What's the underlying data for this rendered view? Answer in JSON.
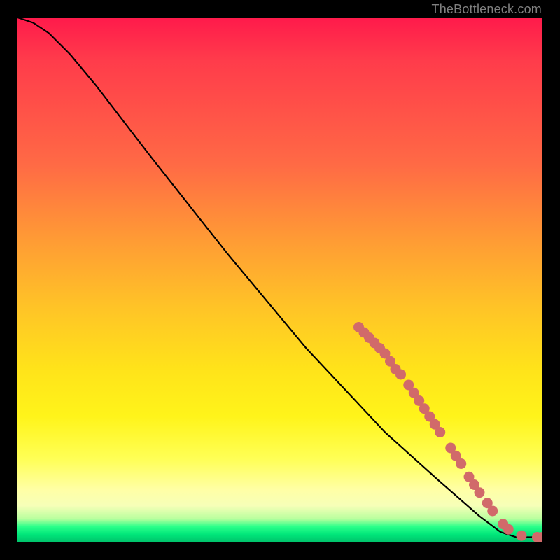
{
  "watermark": "TheBottleneck.com",
  "colors": {
    "marker": "#d16a6a",
    "curve": "#000000",
    "gradient_top": "#ff1a4b",
    "gradient_bottom": "#00c06a"
  },
  "chart_data": {
    "type": "line",
    "title": "",
    "xlabel": "",
    "ylabel": "",
    "xlim": [
      0,
      100
    ],
    "ylim": [
      0,
      100
    ],
    "grid": false,
    "legend": false,
    "curve_points": [
      {
        "x": 0,
        "y": 100
      },
      {
        "x": 3,
        "y": 99
      },
      {
        "x": 6,
        "y": 97
      },
      {
        "x": 10,
        "y": 93
      },
      {
        "x": 15,
        "y": 87
      },
      {
        "x": 25,
        "y": 74
      },
      {
        "x": 40,
        "y": 55
      },
      {
        "x": 55,
        "y": 37
      },
      {
        "x": 70,
        "y": 21
      },
      {
        "x": 80,
        "y": 12
      },
      {
        "x": 88,
        "y": 5
      },
      {
        "x": 92,
        "y": 2
      },
      {
        "x": 95,
        "y": 1
      },
      {
        "x": 100,
        "y": 1
      }
    ],
    "markers": [
      {
        "x": 65.0,
        "y": 41.0
      },
      {
        "x": 66.0,
        "y": 40.0
      },
      {
        "x": 67.0,
        "y": 39.0
      },
      {
        "x": 68.0,
        "y": 38.0
      },
      {
        "x": 69.0,
        "y": 37.0
      },
      {
        "x": 70.0,
        "y": 36.0
      },
      {
        "x": 71.0,
        "y": 34.5
      },
      {
        "x": 72.0,
        "y": 33.0
      },
      {
        "x": 73.0,
        "y": 32.0
      },
      {
        "x": 74.5,
        "y": 30.0
      },
      {
        "x": 75.5,
        "y": 28.5
      },
      {
        "x": 76.5,
        "y": 27.0
      },
      {
        "x": 77.5,
        "y": 25.5
      },
      {
        "x": 78.5,
        "y": 24.0
      },
      {
        "x": 79.5,
        "y": 22.5
      },
      {
        "x": 80.5,
        "y": 21.0
      },
      {
        "x": 82.5,
        "y": 18.0
      },
      {
        "x": 83.5,
        "y": 16.5
      },
      {
        "x": 84.5,
        "y": 15.0
      },
      {
        "x": 86.0,
        "y": 12.5
      },
      {
        "x": 87.0,
        "y": 11.0
      },
      {
        "x": 88.0,
        "y": 9.5
      },
      {
        "x": 89.5,
        "y": 7.5
      },
      {
        "x": 90.5,
        "y": 6.0
      },
      {
        "x": 92.5,
        "y": 3.5
      },
      {
        "x": 93.5,
        "y": 2.5
      },
      {
        "x": 96.0,
        "y": 1.3
      },
      {
        "x": 99.0,
        "y": 1.0
      },
      {
        "x": 100.0,
        "y": 1.0
      }
    ]
  }
}
